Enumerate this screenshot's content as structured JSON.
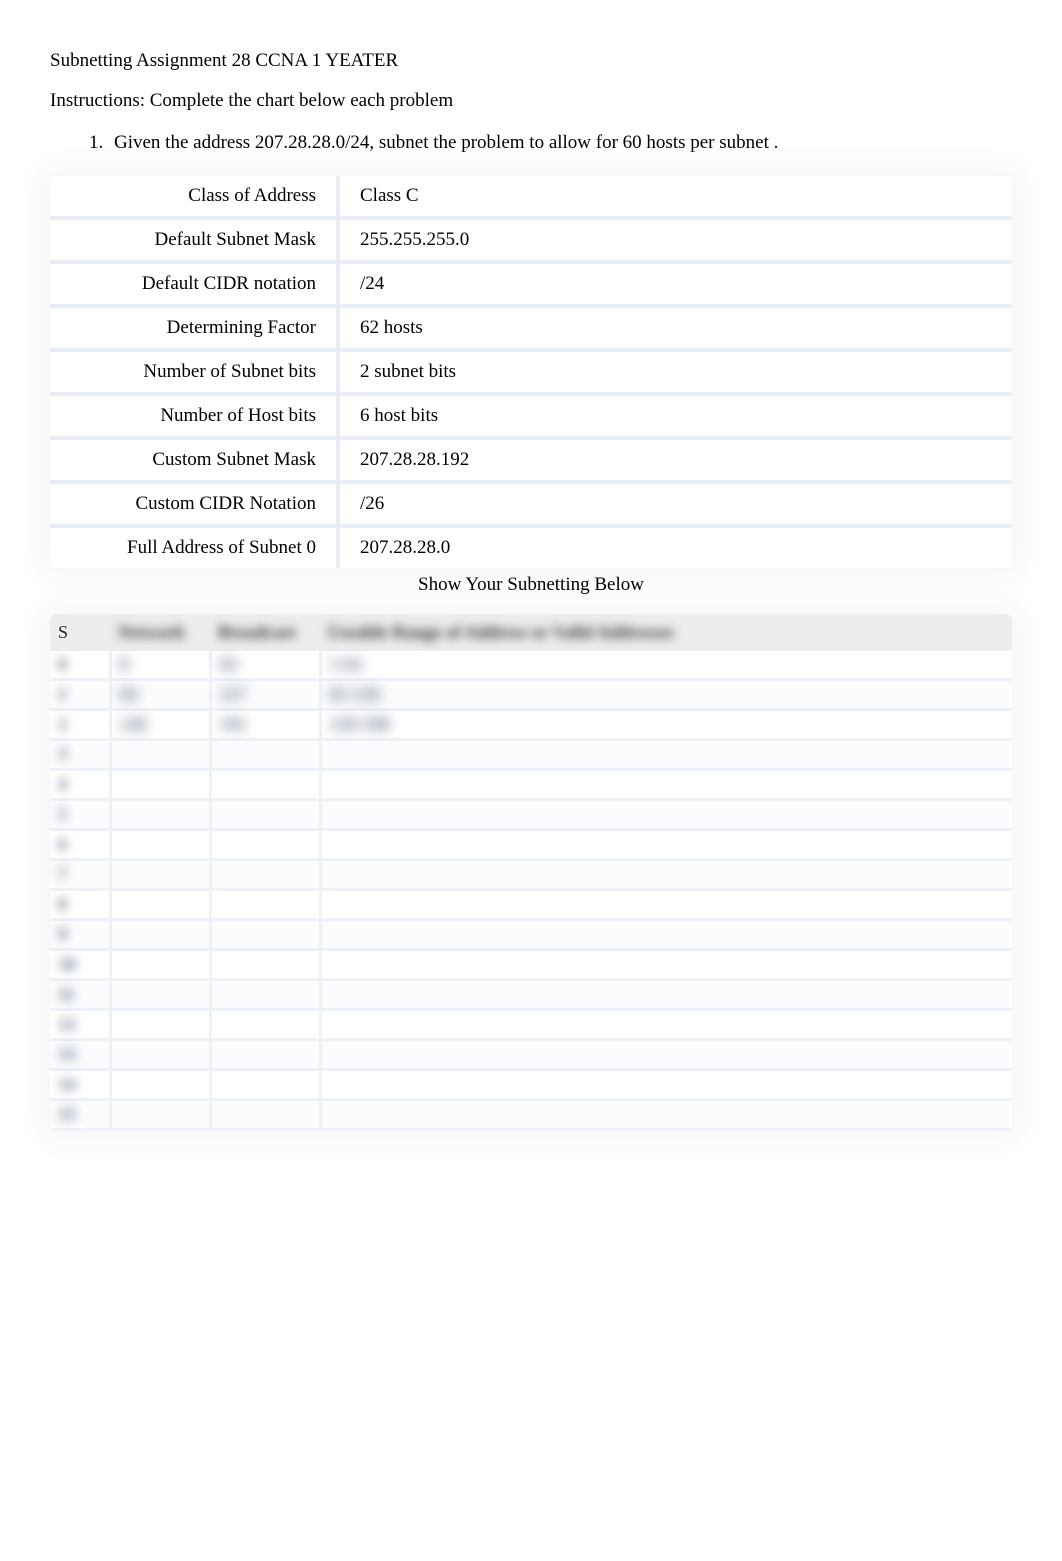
{
  "title": "Subnetting Assignment 28 CCNA 1 YEATER",
  "instructions": "Instructions: Complete the chart below each problem",
  "problem": "Given the address 207.28.28.0/24, subnet the problem to allow for 60 hosts per subnet   .",
  "properties": [
    {
      "label": "Class of Address",
      "value": "Class C"
    },
    {
      "label": "Default Subnet Mask",
      "value": "255.255.255.0"
    },
    {
      "label": "Default CIDR notation",
      "value": "/24"
    },
    {
      "label": "Determining Factor",
      "value": "62 hosts"
    },
    {
      "label": "Number of Subnet bits",
      "value": "2 subnet bits"
    },
    {
      "label": "Number of Host bits",
      "value": "6 host bits"
    },
    {
      "label": "Custom Subnet Mask",
      "value": "207.28.28.192"
    },
    {
      "label": "Custom CIDR Notation",
      "value": "/26"
    },
    {
      "label": "Full Address of Subnet 0",
      "value": "207.28.28.0"
    }
  ],
  "show_text": "Show Your Subnetting Below",
  "chart_headers": {
    "s": "S",
    "network": "Network",
    "broadcast": "Broadcast",
    "range": "Useable Range of Address or Valid Addresses"
  },
  "chart_rows": [
    {
      "s": "0",
      "net": "0",
      "bcast": "63",
      "range": "1-62"
    },
    {
      "s": "1",
      "net": "64",
      "bcast": "127",
      "range": "65-126"
    },
    {
      "s": "2",
      "net": "128",
      "bcast": "191",
      "range": "129-190"
    },
    {
      "s": "3",
      "net": "",
      "bcast": "",
      "range": ""
    },
    {
      "s": "4",
      "net": "",
      "bcast": "",
      "range": ""
    },
    {
      "s": "5",
      "net": "",
      "bcast": "",
      "range": ""
    },
    {
      "s": "6",
      "net": "",
      "bcast": "",
      "range": ""
    },
    {
      "s": "7",
      "net": "",
      "bcast": "",
      "range": ""
    },
    {
      "s": "8",
      "net": "",
      "bcast": "",
      "range": ""
    },
    {
      "s": "9",
      "net": "",
      "bcast": "",
      "range": ""
    },
    {
      "s": "10",
      "net": "",
      "bcast": "",
      "range": ""
    },
    {
      "s": "11",
      "net": "",
      "bcast": "",
      "range": ""
    },
    {
      "s": "12",
      "net": "",
      "bcast": "",
      "range": ""
    },
    {
      "s": "13",
      "net": "",
      "bcast": "",
      "range": ""
    },
    {
      "s": "14",
      "net": "",
      "bcast": "",
      "range": ""
    },
    {
      "s": "15",
      "net": "",
      "bcast": "",
      "range": ""
    }
  ]
}
